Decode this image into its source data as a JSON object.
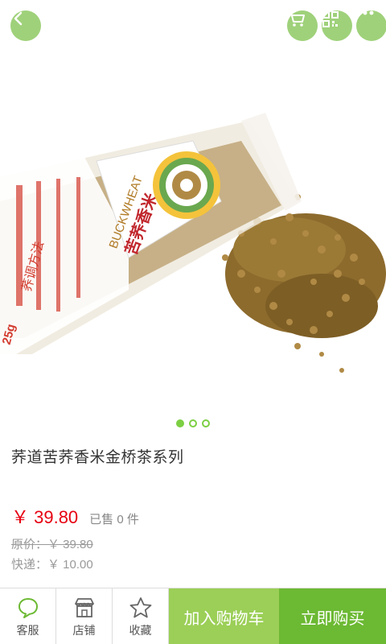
{
  "product": {
    "title": "荞道苦荞香米金桥茶系列",
    "price": "￥ 39.80",
    "sold": "已售 0 件",
    "original_price": "原价：￥ 39.80",
    "shipping": "快递：￥ 10.00",
    "image_label": "荞调方法",
    "image_brand_en": "BUCKWHEAT",
    "image_brand_cn": "苦荞香米",
    "image_weight": "25g",
    "carousel_count": 3,
    "carousel_active": 0
  },
  "header": {
    "back_icon": "chevron-left-icon",
    "cart_icon": "cart-icon",
    "qr_icon": "qrcode-icon",
    "more_icon": "ellipsis-icon"
  },
  "bottom_bar": {
    "service": "客服",
    "shop": "店铺",
    "favorite": "收藏",
    "add_to_cart": "加入购物车",
    "buy_now": "立即购买"
  },
  "colors": {
    "accent": "#9fd17a",
    "price": "#e60012",
    "add_to_cart_bg": "#9bcf57",
    "buy_now_bg": "#6cb933"
  }
}
